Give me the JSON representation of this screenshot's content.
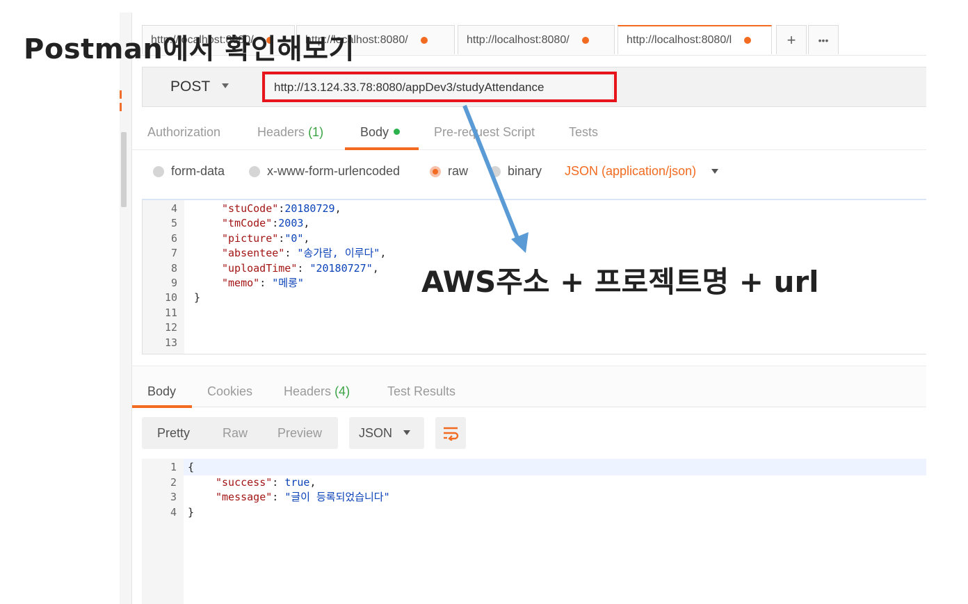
{
  "annotation": {
    "caption": "Postman에서 확인해보기",
    "aws_note": "AWS주소 + 프로젝트명 + url",
    "highlight_color": "#e8141c",
    "arrow_color": "#5b9bd5"
  },
  "tabs": [
    {
      "label": "http://localhost:8080/",
      "unsaved": true
    },
    {
      "label": "http://localhost:8080/",
      "unsaved": true
    },
    {
      "label": "http://localhost:8080/",
      "unsaved": true
    },
    {
      "label": "http://localhost:8080/l",
      "unsaved": true,
      "active": true
    }
  ],
  "tab_actions": {
    "add": "+",
    "more": "•••"
  },
  "request": {
    "method": "POST",
    "url": "http://13.124.33.78:8080/appDev3/studyAttendance"
  },
  "request_tabs": {
    "authorization": "Authorization",
    "headers": "Headers",
    "headers_count": "(1)",
    "body": "Body",
    "prerequest": "Pre-request Script",
    "tests": "Tests"
  },
  "body_modes": {
    "form_data": "form-data",
    "urlencoded": "x-www-form-urlencoded",
    "raw": "raw",
    "binary": "binary",
    "content_type": "JSON (application/json)"
  },
  "request_body": {
    "lines": [
      {
        "num": "4",
        "key": "\"stuCode\"",
        "sep": ":",
        "val": "20180729",
        "tail": ","
      },
      {
        "num": "5",
        "key": "\"tmCode\"",
        "sep": ":",
        "val": "2003",
        "tail": ","
      },
      {
        "num": "6",
        "key": "\"picture\"",
        "sep": ":",
        "val": "\"0\"",
        "tail": ","
      },
      {
        "num": "7",
        "key": "\"absentee\"",
        "sep": ": ",
        "val": "\"송가람, 이루다\"",
        "tail": ","
      },
      {
        "num": "8",
        "key": "\"uploadTime\"",
        "sep": ": ",
        "val": "\"20180727\"",
        "tail": ","
      },
      {
        "num": "9",
        "key": "\"memo\"",
        "sep": ": ",
        "val": "\"메롱\"",
        "tail": ""
      },
      {
        "num": "10",
        "key": "",
        "sep": "}",
        "val": "",
        "tail": ""
      },
      {
        "num": "11",
        "key": "",
        "sep": "",
        "val": "",
        "tail": ""
      },
      {
        "num": "12",
        "key": "",
        "sep": "",
        "val": "",
        "tail": ""
      },
      {
        "num": "13",
        "key": "",
        "sep": "",
        "val": "",
        "tail": ""
      }
    ]
  },
  "response_tabs": {
    "body": "Body",
    "cookies": "Cookies",
    "headers": "Headers",
    "headers_count": "(4)",
    "test_results": "Test Results"
  },
  "response_toolbar": {
    "pretty": "Pretty",
    "raw": "Raw",
    "preview": "Preview",
    "format": "JSON"
  },
  "response_body": {
    "lines": [
      {
        "num": "1",
        "text": "{"
      },
      {
        "num": "2",
        "key": "\"success\"",
        "sep": ": ",
        "val": "true",
        "tail": ","
      },
      {
        "num": "3",
        "key": "\"message\"",
        "sep": ": ",
        "val": "\"글이 등록되었습니다\"",
        "tail": ""
      },
      {
        "num": "4",
        "text": "}"
      }
    ]
  }
}
